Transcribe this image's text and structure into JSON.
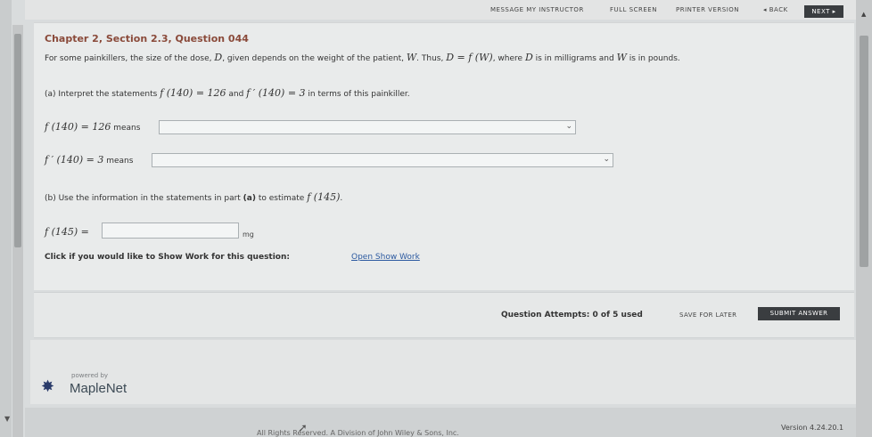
{
  "toolbar": {
    "message_instructor": "MESSAGE MY INSTRUCTOR",
    "full_screen": "FULL SCREEN",
    "printer_version": "PRINTER VERSION",
    "back": "◂ BACK",
    "next": "NEXT ▸"
  },
  "question": {
    "header": "Chapter 2, Section 2.3, Question 044",
    "intro_parts": {
      "a": "For some painkillers, the size of the dose, ",
      "D": "D",
      "b": ", given depends on the weight of the patient, ",
      "W": "W",
      "c": ". Thus, ",
      "eq": "D = f (W)",
      "d": ", where ",
      "D2": "D",
      "e": " is in milligrams and ",
      "W2": "W",
      "f": " is in pounds."
    },
    "part_a": {
      "prefix": "(a) Interpret the statements ",
      "stmt1": "f (140) = 126",
      "and": " and ",
      "stmt2": "f ′ (140) = 3",
      "suffix": " in terms of this painkiller."
    },
    "row1": {
      "expr": "f (140) = 126",
      "means": "means"
    },
    "row2": {
      "expr": "f ′ (140) = 3",
      "means": "means"
    },
    "part_b": {
      "prefix": "(b) Use the information in the statements in part ",
      "a_ref": "(a)",
      "mid": " to estimate ",
      "expr": "f (145)",
      "suffix": "."
    },
    "row3": {
      "expr": "f (145) =",
      "unit": "mg"
    },
    "show_work": {
      "label": "Click if you would like to Show Work for this question:",
      "link": "Open Show Work"
    }
  },
  "attempts": {
    "text": "Question Attempts: 0 of 5 used",
    "save_later": "SAVE FOR LATER",
    "submit": "SUBMIT ANSWER"
  },
  "footer": {
    "powered_by": "powered by",
    "brand": "MapleNet",
    "copyright": "All Rights Reserved. A Division of John Wiley & Sons, Inc.",
    "version": "Version 4.24.20.1"
  },
  "colors": {
    "header_text": "#8a4a3a",
    "link": "#2c5aa0",
    "dark_button": "#3a3d40"
  }
}
